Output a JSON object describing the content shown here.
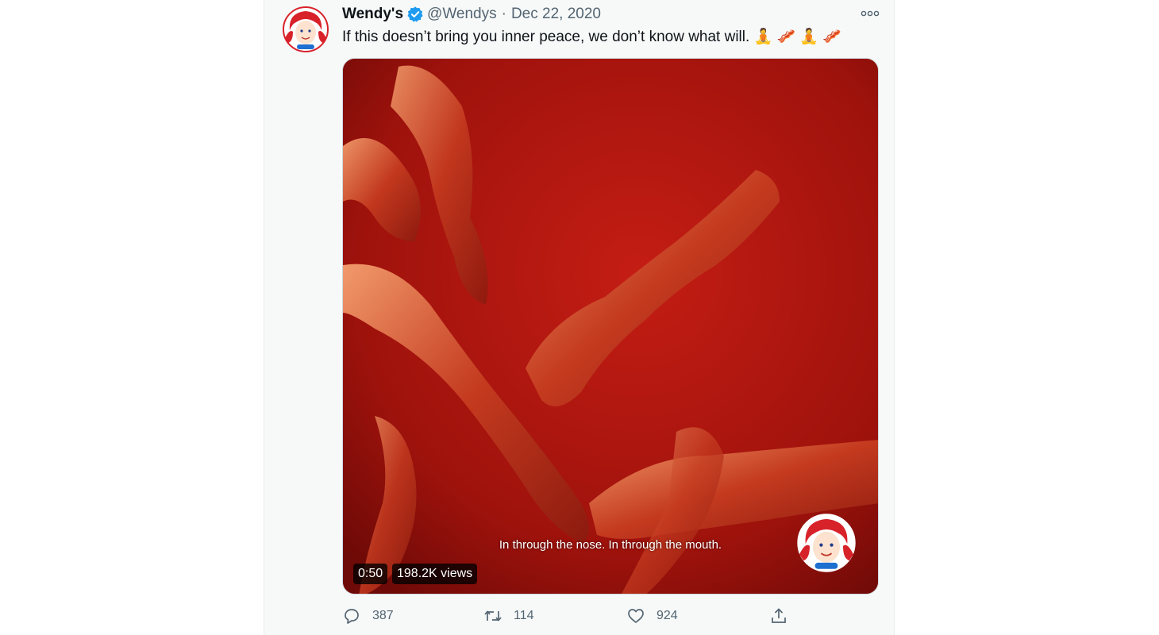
{
  "tweet": {
    "display_name": "Wendy's",
    "handle": "@Wendys",
    "separator": "·",
    "date": "Dec 22, 2020",
    "text": "If this doesn’t bring you inner peace, we don’t know what will. 🧘 🥓 🧘 🥓",
    "verified": true
  },
  "media": {
    "caption": "In through the nose. In through the mouth.",
    "duration": "0:50",
    "views": "198.2K views"
  },
  "actions": {
    "reply_count": "387",
    "retweet_count": "114",
    "like_count": "924"
  },
  "icons": {
    "reply": "reply-icon",
    "retweet": "retweet-icon",
    "like": "heart-icon",
    "share": "share-icon",
    "more": "more-icon",
    "verified": "verified-badge-icon"
  },
  "colors": {
    "brand_red": "#d8222a",
    "verified_blue": "#1d9bf0",
    "secondary_text": "#536471"
  }
}
